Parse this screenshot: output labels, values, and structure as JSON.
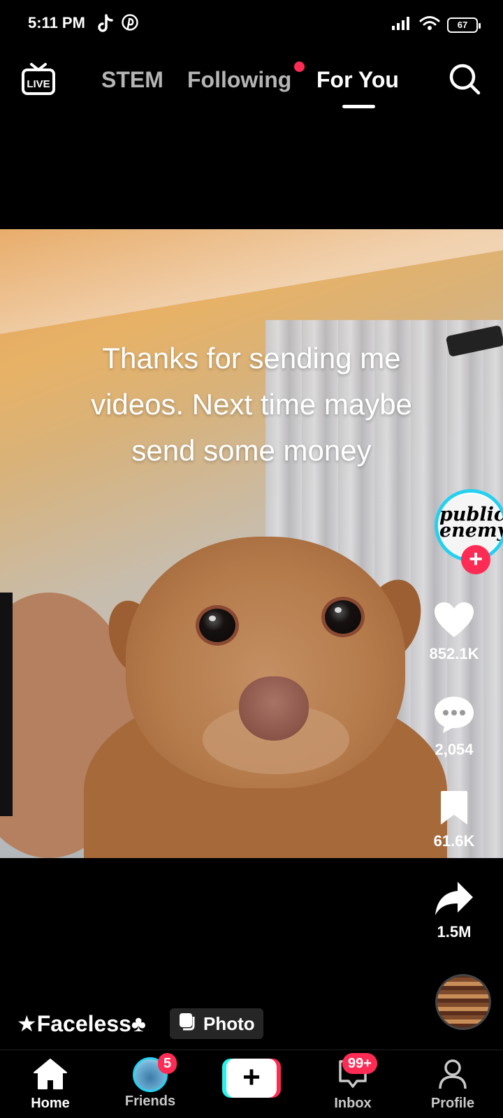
{
  "status_bar": {
    "time": "5:11 PM",
    "app_icons": [
      "tiktok-icon",
      "pinterest-icon"
    ],
    "battery": "67"
  },
  "top_nav": {
    "live_label": "LIVE",
    "tabs": [
      {
        "label": "STEM",
        "active": false
      },
      {
        "label": "Following",
        "active": false,
        "has_dot": true
      },
      {
        "label": "For You",
        "active": true
      }
    ]
  },
  "video": {
    "caption_lines": [
      "Thanks for sending me",
      "videos. Next time maybe",
      "send some money"
    ]
  },
  "right_rail": {
    "avatar_text": "public enemy",
    "likes": "852.1K",
    "comments": "2,054",
    "saves": "61.6K",
    "shares": "1.5M"
  },
  "meta": {
    "author": "★Faceless♣",
    "type_badge": "Photo"
  },
  "bottom_nav": {
    "home": "Home",
    "friends": "Friends",
    "friends_badge": "5",
    "inbox": "Inbox",
    "inbox_badge": "99+",
    "profile": "Profile"
  },
  "colors": {
    "accent_red": "#fe2c55",
    "accent_cyan": "#25f4ee"
  }
}
